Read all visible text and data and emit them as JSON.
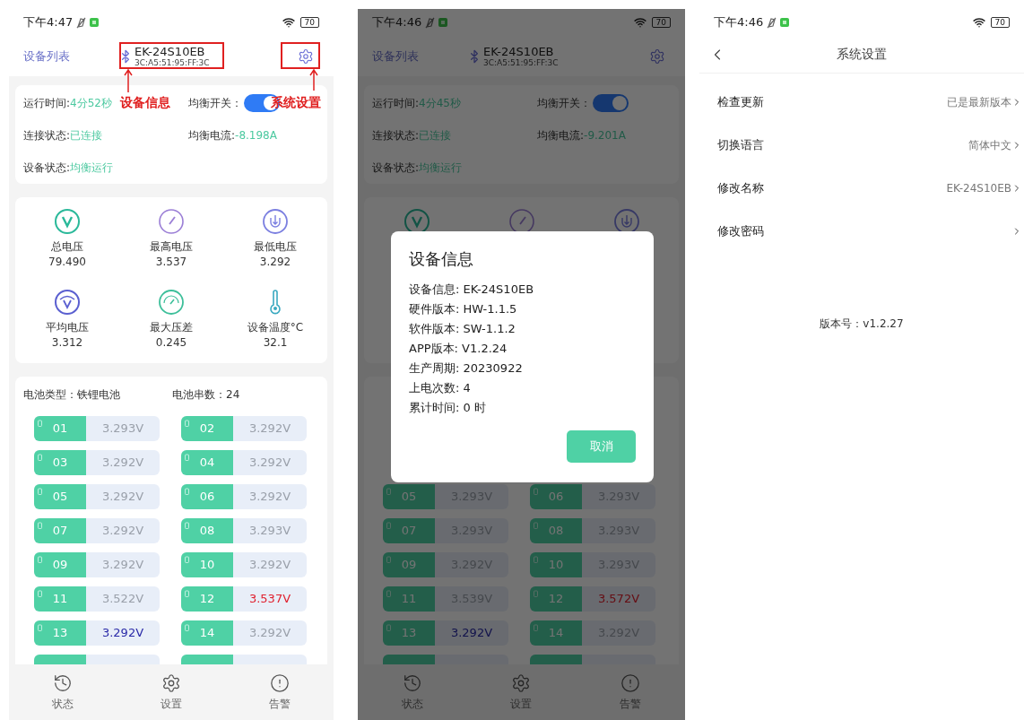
{
  "screens": [
    {
      "kind": "dashboard",
      "status_bar": {
        "time": "下午4:47",
        "battery": "70"
      },
      "header": {
        "back_link": "设备列表",
        "device_name": "EK-24S10EB",
        "mac": "3C:A5:51:95:FF:3C"
      },
      "status": {
        "run_time_label": "运行时间:",
        "run_time": "4分52秒",
        "balance_switch_label": "均衡开关：",
        "balance_on": true,
        "connection_label": "连接状态:",
        "connection": "已连接",
        "balance_current_label": "均衡电流:",
        "balance_current": "-8.198A",
        "device_state_label": "设备状态:",
        "device_state": "均衡运行"
      },
      "metrics": [
        {
          "kind": "total",
          "label": "总电压",
          "value": "79.490"
        },
        {
          "kind": "max",
          "label": "最高电压",
          "value": "3.537"
        },
        {
          "kind": "min",
          "label": "最低电压",
          "value": "3.292"
        },
        {
          "kind": "avg",
          "label": "平均电压",
          "value": "3.312"
        },
        {
          "kind": "diff",
          "label": "最大压差",
          "value": "0.245"
        },
        {
          "kind": "temp",
          "label": "设备温度°C",
          "value": "32.1"
        }
      ],
      "battery": {
        "type_label": "电池类型：铁锂电池",
        "count_label": "电池串数：24",
        "cells": [
          {
            "index": "01",
            "voltage": "3.293V",
            "kind": "normal"
          },
          {
            "index": "02",
            "voltage": "3.292V",
            "kind": "normal"
          },
          {
            "index": "03",
            "voltage": "3.292V",
            "kind": "normal"
          },
          {
            "index": "04",
            "voltage": "3.292V",
            "kind": "normal"
          },
          {
            "index": "05",
            "voltage": "3.292V",
            "kind": "normal"
          },
          {
            "index": "06",
            "voltage": "3.292V",
            "kind": "normal"
          },
          {
            "index": "07",
            "voltage": "3.292V",
            "kind": "normal"
          },
          {
            "index": "08",
            "voltage": "3.293V",
            "kind": "normal"
          },
          {
            "index": "09",
            "voltage": "3.292V",
            "kind": "normal"
          },
          {
            "index": "10",
            "voltage": "3.292V",
            "kind": "normal"
          },
          {
            "index": "11",
            "voltage": "3.522V",
            "kind": "normal"
          },
          {
            "index": "12",
            "voltage": "3.537V",
            "kind": "max"
          },
          {
            "index": "13",
            "voltage": "3.292V",
            "kind": "min"
          },
          {
            "index": "14",
            "voltage": "3.292V",
            "kind": "normal"
          }
        ]
      },
      "nav": [
        {
          "kind": "status",
          "label": "状态"
        },
        {
          "kind": "settings",
          "label": "设置"
        },
        {
          "kind": "alarm",
          "label": "告警"
        }
      ],
      "annotations": [
        {
          "kind": "device_info",
          "label": "设备信息"
        },
        {
          "kind": "settings",
          "label": "系统设置"
        }
      ]
    },
    {
      "kind": "dashboard",
      "status_bar": {
        "time": "下午4:46",
        "battery": "70"
      },
      "header": {
        "back_link": "设备列表",
        "device_name": "EK-24S10EB",
        "mac": "3C:A5:51:95:FF:3C"
      },
      "status": {
        "run_time_label": "运行时间:",
        "run_time": "4分45秒",
        "balance_switch_label": "均衡开关：",
        "balance_on": true,
        "connection_label": "连接状态:",
        "connection": "已连接",
        "balance_current_label": "均衡电流:",
        "balance_current": "-9.201A",
        "device_state_label": "设备状态:",
        "device_state": "均衡运行"
      },
      "metrics": [
        {
          "kind": "total"
        },
        {
          "kind": "max"
        },
        {
          "kind": "min"
        }
      ],
      "battery": {
        "cells": [
          {
            "index": "05",
            "voltage": "3.293V",
            "kind": "normal"
          },
          {
            "index": "06",
            "voltage": "3.293V",
            "kind": "normal"
          },
          {
            "index": "07",
            "voltage": "3.293V",
            "kind": "normal"
          },
          {
            "index": "08",
            "voltage": "3.293V",
            "kind": "normal"
          },
          {
            "index": "09",
            "voltage": "3.292V",
            "kind": "normal"
          },
          {
            "index": "10",
            "voltage": "3.293V",
            "kind": "normal"
          },
          {
            "index": "11",
            "voltage": "3.539V",
            "kind": "normal"
          },
          {
            "index": "12",
            "voltage": "3.572V",
            "kind": "max"
          },
          {
            "index": "13",
            "voltage": "3.292V",
            "kind": "min"
          },
          {
            "index": "14",
            "voltage": "3.292V",
            "kind": "normal"
          }
        ]
      },
      "nav": [
        {
          "kind": "status",
          "label": "状态"
        },
        {
          "kind": "settings",
          "label": "设置"
        },
        {
          "kind": "alarm",
          "label": "告警"
        }
      ],
      "dialog": {
        "title": "设备信息",
        "lines": [
          "设备信息: EK-24S10EB",
          "硬件版本: HW-1.1.5",
          "软件版本: SW-1.1.2",
          "APP版本: V1.2.24",
          "生产周期: 20230922",
          "上电次数: 4",
          "累计时间: 0 时"
        ],
        "button": "取消"
      }
    },
    {
      "kind": "settings",
      "status_bar": {
        "time": "下午4:46",
        "battery": "70"
      },
      "title": "系统设置",
      "rows": [
        {
          "label": "检查更新",
          "value": "已是最新版本"
        },
        {
          "label": "切换语言",
          "value": "简体中文"
        },
        {
          "label": "修改名称",
          "value": "EK-24S10EB"
        },
        {
          "label": "修改密码"
        }
      ],
      "version": "版本号：v1.2.27"
    }
  ]
}
